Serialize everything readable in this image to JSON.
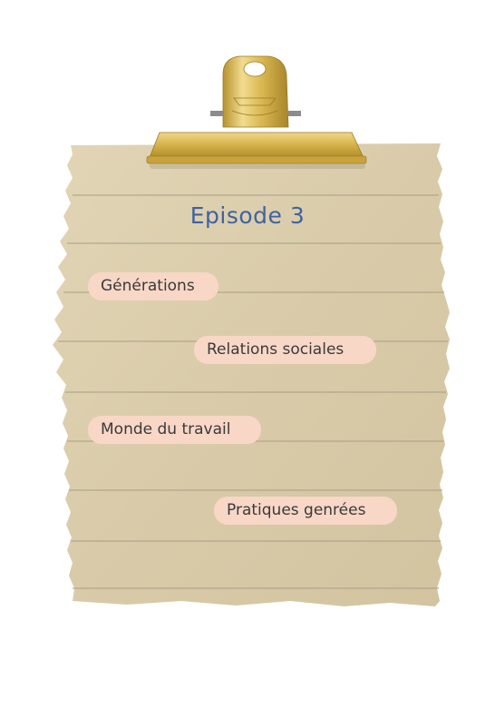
{
  "title": "Episode 3",
  "topics": [
    {
      "label": "Générations"
    },
    {
      "label": "Relations sociales"
    },
    {
      "label": "Monde du travail"
    },
    {
      "label": "Pratiques genrées"
    }
  ],
  "colors": {
    "paper": "#dccfae",
    "line": "#a79d86",
    "chip": "#f8d7c6",
    "title": "#3f62a2",
    "clip_gold": "#d6b24a"
  },
  "icons": {
    "clip": "binder-clip-icon"
  }
}
